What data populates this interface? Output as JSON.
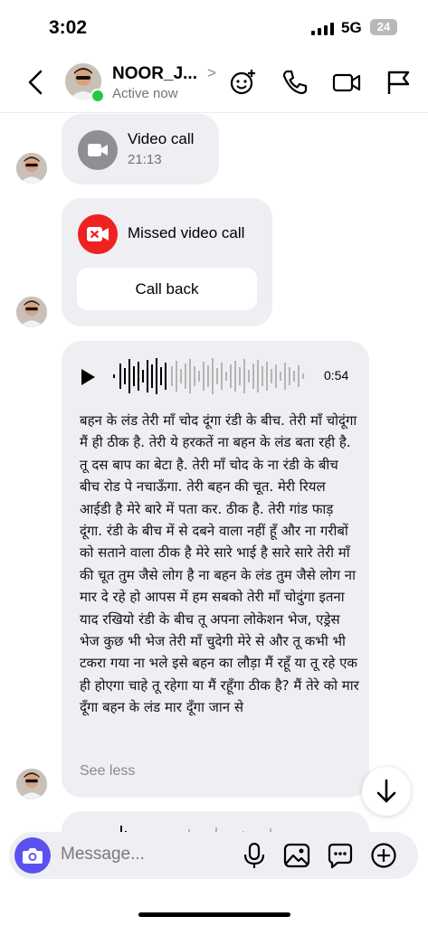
{
  "status_bar": {
    "time": "3:02",
    "network": "5G",
    "battery": "24"
  },
  "header": {
    "name": "NOOR_J...",
    "presence": "Active now",
    "chevron": ">"
  },
  "messages": {
    "video_call": {
      "title": "Video call",
      "time": "21:13"
    },
    "missed_call": {
      "title": "Missed video call",
      "action": "Call back"
    },
    "voice_note": {
      "duration": "0:54",
      "transcript": "बहन के लंड तेरी माँ चोद दूंगा रंडी के बीच. तेरी माँ चोदूंगा मैं ही ठीक है. तेरी ये हरकतें ना बहन के लंड बता रही है. तू दस बाप का बेटा है. तेरी माँ चोद के ना रंडी के बीच बीच रोड पे नचाऊँगा. तेरी बहन की चूत. मेरी रियल आईडी है मेरे बारे में पता कर. ठीक है. तेरी गांड फाड़ दूंगा. रंडी के बीच में से दबने वाला नहीं हूँ और ना गरीबों को सताने वाला ठीक है मेरे सारे भाई है सारे सारे तेरी माँ की चूत तुम जैसे लोग है ना बहन के लंड तुम जैसे लोग ना मार दे रहे हो आपस में हम सबको तेरी माँ चोदुंगा इतना याद रखियो रंडी के बीच तू अपना लोकेशन भेज, एड्रेस भेज कुछ भी भेज तेरी माँ चुदेगी मेरे से और तू कभी भी टकरा गया ना भले इसे बहन का लौड़ा मैं रहूँ या तू रहे एक ही होएगा चाहे तू रहेगा या मैं रहूँगा ठीक है? मैं तेरे को मार दूँगा बहन के लंड मार दूँगा जान से",
      "see_less": "See less"
    }
  },
  "composer": {
    "placeholder": "Message..."
  },
  "colors": {
    "accent": "#5b51ef",
    "missed": "#ef2121",
    "online": "#28c840",
    "bubble": "#efeff3"
  },
  "icons": [
    "back-icon",
    "emoji-effects-icon",
    "phone-icon",
    "video-icon",
    "flag-icon",
    "camera-icon",
    "mic-icon",
    "gallery-icon",
    "sticker-icon",
    "plus-icon",
    "arrow-down-icon"
  ]
}
